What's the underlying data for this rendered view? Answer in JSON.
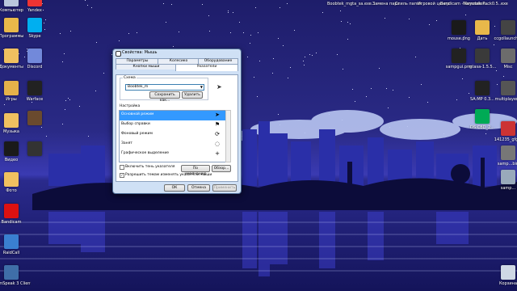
{
  "desktop": {
    "left_icons": [
      {
        "label": "Компьютер",
        "color": "#b9c7dc"
      },
      {
        "label": "Программы",
        "color": "#e8b84a"
      },
      {
        "label": "Документы",
        "color": "#f0c060"
      },
      {
        "label": "Игры",
        "color": "#e5b24a"
      },
      {
        "label": "Музыка",
        "color": "#f0c060"
      },
      {
        "label": "Видео",
        "color": "#1a1a1a"
      },
      {
        "label": "Фото",
        "color": "#f0c060"
      },
      {
        "label": "Bandicam",
        "color": "#d11"
      },
      {
        "label": "RaidCall",
        "color": "#3a7fd0"
      },
      {
        "label": "TeamSpeak 3 Client",
        "color": "#3f6ea8"
      }
    ],
    "second_col_icons": [
      {
        "label": "Yandex",
        "color": "#e33"
      },
      {
        "label": "Skype",
        "color": "#00aff0"
      },
      {
        "label": "Discord",
        "color": "#7289da"
      },
      {
        "label": "Warface",
        "color": "#222"
      },
      {
        "label": "",
        "color": "#6a4a2e"
      },
      {
        "label": "",
        "color": "#333"
      }
    ],
    "top_row_labels": [
      "Boobtek_m",
      "gta_sa.exe...",
      "Замена пара",
      "Стиль папок",
      "Игровой центр",
      "Bandicam - Keymaker...",
      "Namutek Pack0.5..exe"
    ],
    "right_icons": [
      {
        "label": "mouse.png",
        "color": "#1a1a1a"
      },
      {
        "label": "Дать",
        "color": "#e8b84a"
      },
      {
        "label": "ccgollauncher",
        "color": "#444"
      },
      {
        "label": "sampgui.png",
        "color": "#222"
      },
      {
        "label": "mtasa-1.5.5...",
        "color": "#3a3a3a"
      },
      {
        "label": "Misc",
        "color": "#6c6c6c"
      },
      {
        "label": "SA:MP 0.3...",
        "color": "#222"
      },
      {
        "label": "multiplayer...",
        "color": "#555"
      },
      {
        "label": "DS:CBD_2...",
        "color": "#0a5"
      },
      {
        "label": "141235_gfg...",
        "color": "#c33"
      },
      {
        "label": "samp...bin",
        "color": "#777"
      },
      {
        "label": "samp...",
        "color": "#99aabb"
      },
      {
        "label": "Корзина",
        "color": "#cfd8e5"
      }
    ]
  },
  "dialog": {
    "title": "Свойства: Мышь",
    "tabs_row1": [
      "Параметры указателя",
      "Колесико",
      "Оборудование"
    ],
    "tabs_row2": [
      "Кнопки мыши",
      "Указатели"
    ],
    "scheme_label": "Схема",
    "scheme_value": "Boobtek_m",
    "save_as": "Сохранить как...",
    "delete": "Удалить",
    "customize_label": "Настройка",
    "rows": [
      {
        "label": "Основной режим",
        "selected": true,
        "glyph": "➤"
      },
      {
        "label": "Выбор справки",
        "selected": false,
        "glyph": "⚑"
      },
      {
        "label": "Фоновый режим",
        "selected": false,
        "glyph": "⟳"
      },
      {
        "label": "Занят",
        "selected": false,
        "glyph": "◌"
      },
      {
        "label": "Графическое выделение",
        "selected": false,
        "glyph": "+"
      }
    ],
    "shadow_label": "Включить тень указателя",
    "shadow_checked": false,
    "default_btn": "По умолчанию",
    "browse_btn": "Обзор...",
    "themes_label": "Разрешить темам изменять указатели мыши",
    "themes_checked": true,
    "ok": "ОК",
    "cancel": "Отмена",
    "apply": "Применить"
  }
}
